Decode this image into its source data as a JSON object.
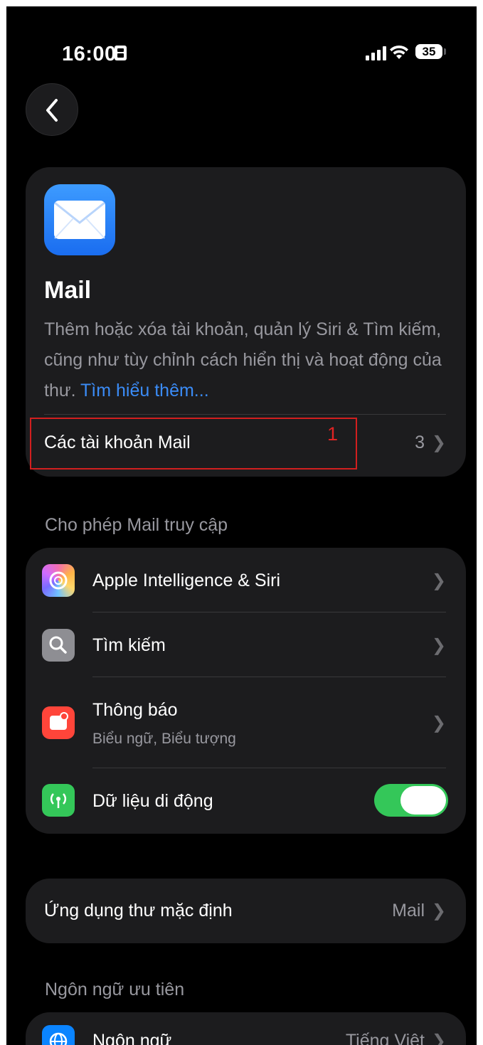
{
  "status_bar": {
    "time": "16:00",
    "battery": "35",
    "icons": [
      "sim-card-icon",
      "cellular-signal-icon",
      "wifi-icon",
      "battery-icon"
    ]
  },
  "nav": {
    "back_icon": "chevron-left-icon"
  },
  "header": {
    "app_name": "Mail",
    "description": "Thêm hoặc xóa tài khoản, quản lý Siri & Tìm kiếm, cũng như tùy chỉnh cách hiển thị và hoạt động của thư.",
    "learn_more": "Tìm hiểu thêm...",
    "accounts_label": "Các tài khoản Mail",
    "accounts_count": "3"
  },
  "annotation": {
    "number": "1",
    "color": "#d21f1f"
  },
  "access_section": {
    "title": "Cho phép Mail truy cập",
    "items": [
      {
        "label": "Apple Intelligence & Siri",
        "icon": "apple-intelligence-icon"
      },
      {
        "label": "Tìm kiếm",
        "icon": "search-icon"
      },
      {
        "label": "Thông báo",
        "subtitle": "Biểu ngữ, Biểu tượng",
        "icon": "notification-icon"
      },
      {
        "label": "Dữ liệu di động",
        "icon": "cellular-antenna-icon",
        "toggle_on": true
      }
    ]
  },
  "default_app": {
    "label": "Ứng dụng thư mặc định",
    "value": "Mail"
  },
  "language_section": {
    "title": "Ngôn ngữ ưu tiên",
    "item_label": "Ngôn ngữ",
    "item_value": "Tiếng Việt",
    "icon": "globe-icon"
  },
  "colors": {
    "background": "#000000",
    "card": "#1c1c1e",
    "link": "#3b8cf7",
    "toggle_on": "#34c759",
    "secondary_text": "#98989f"
  }
}
